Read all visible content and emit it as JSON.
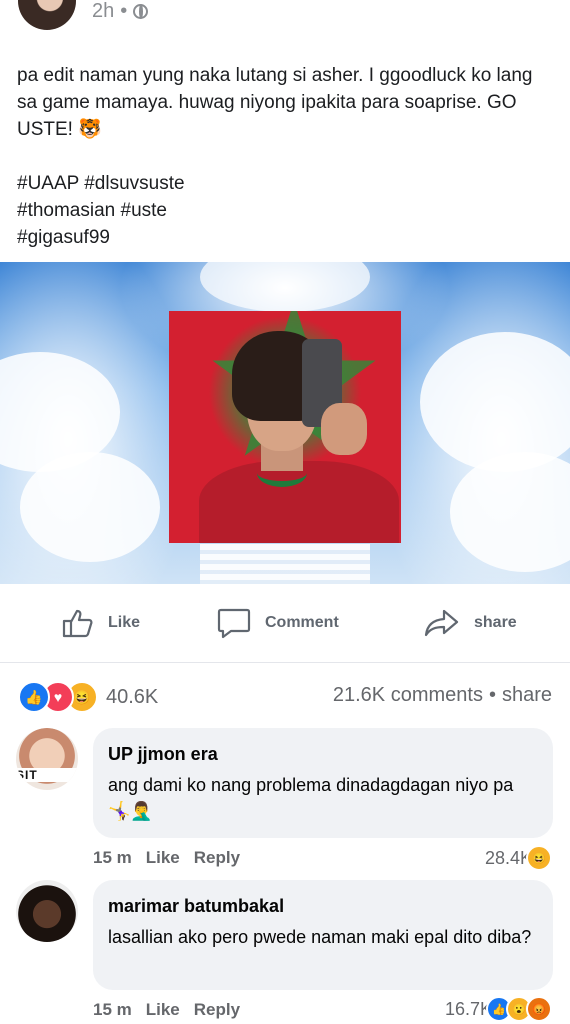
{
  "post": {
    "time": "2h",
    "separator": "•",
    "text": "pa edit naman yung naka lutang si asher. I ggoodluck ko lang sa game mamaya. huwag niyong ipakita para soaprise. GO USTE! 🐯",
    "hashtags": [
      "#UAAP #dlsuvsuste",
      "#thomasian #uste",
      "#gigasuf99"
    ]
  },
  "actions": {
    "like": "Like",
    "comment": "Comment",
    "share": "share"
  },
  "stats": {
    "reactions_count": "40.6K",
    "comments": "21.6K comments",
    "separator": "•",
    "share": "share"
  },
  "comments": [
    {
      "name": "UP jjmon era",
      "text": "ang dami ko nang problema dinadagdagan niyo pa 🤸‍♀️🤦‍♂️",
      "time": "15 m",
      "like": "Like",
      "reply": "Reply",
      "reaction_count": "28.4K",
      "avatar_band": "SIT"
    },
    {
      "name": "marimar batumbakal",
      "text": "lasallian ako pero pwede naman maki epal dito diba?",
      "time": "15 m",
      "like": "Like",
      "reply": "Reply",
      "reaction_count": "16.7K"
    }
  ],
  "colors": {
    "accent": "#1877f2",
    "love": "#f33e58",
    "haha": "#f7b125",
    "muted": "#65676b"
  },
  "icons": [
    "globe-icon",
    "like-thumb-icon",
    "comment-icon",
    "share-arrow-icon",
    "like-reaction-icon",
    "love-reaction-icon",
    "haha-reaction-icon",
    "wow-reaction-icon",
    "angry-reaction-icon"
  ]
}
